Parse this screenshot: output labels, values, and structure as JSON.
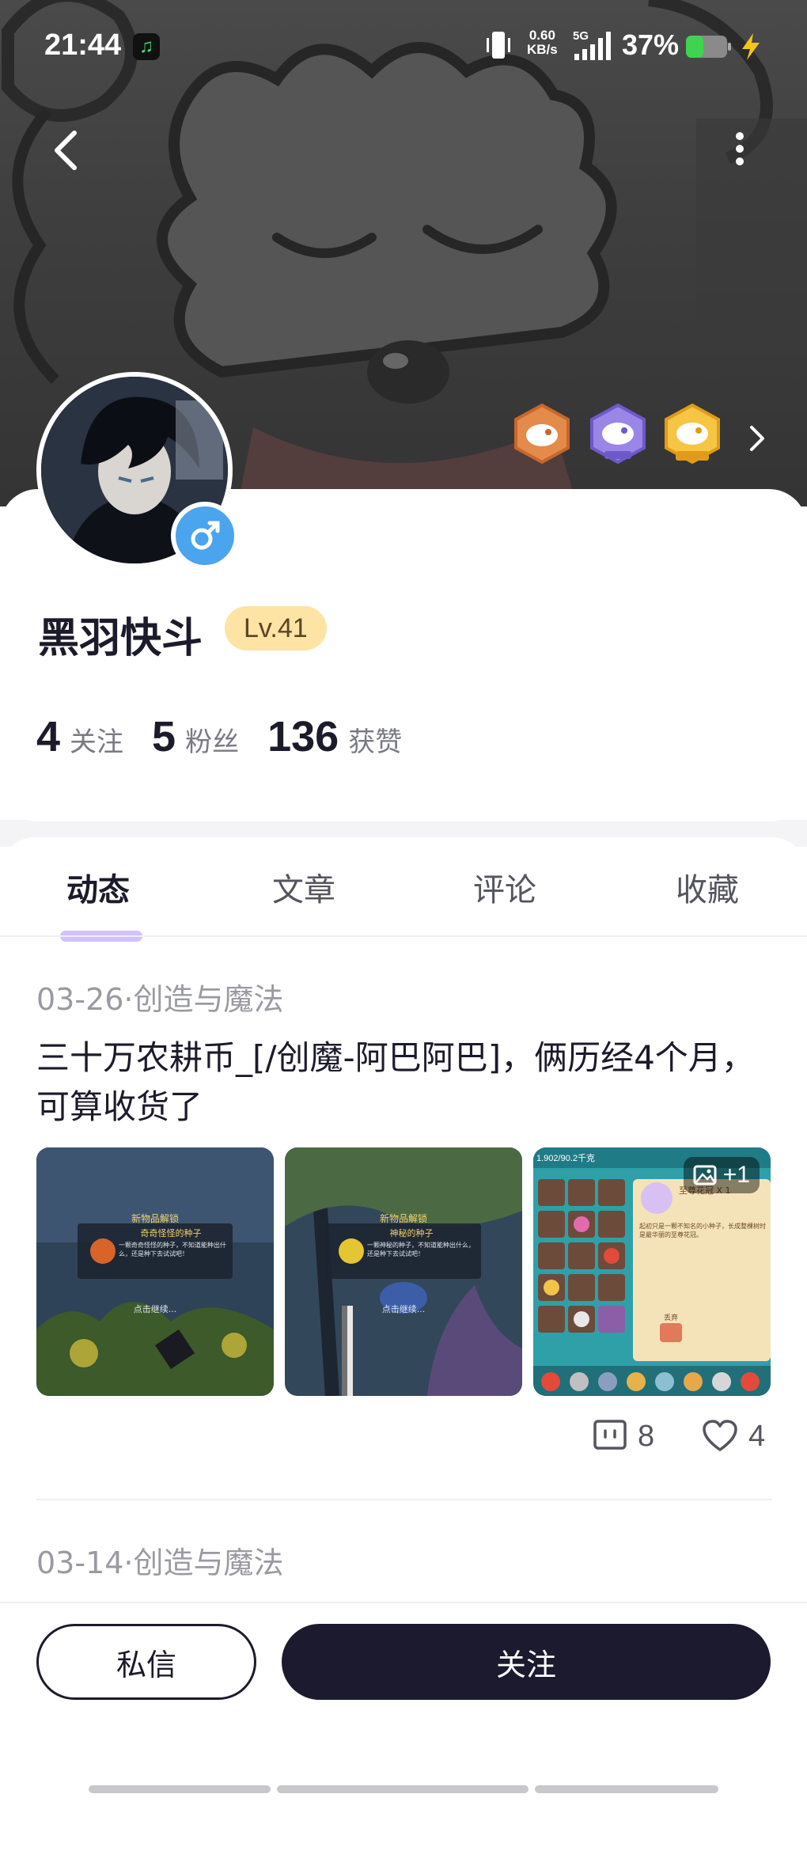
{
  "status_bar": {
    "time": "21:44",
    "net_speed_value": "0.60",
    "net_speed_unit": "KB/s",
    "network": "5G",
    "battery": "37%"
  },
  "profile": {
    "username": "黑羽快斗",
    "level": "Lv.41",
    "stats": [
      {
        "count": "4",
        "label": "关注"
      },
      {
        "count": "5",
        "label": "粉丝"
      },
      {
        "count": "136",
        "label": "获赞"
      }
    ]
  },
  "tabs": [
    "动态",
    "文章",
    "评论",
    "收藏"
  ],
  "posts": [
    {
      "date": "03-26",
      "category": "创造与魔法",
      "title": "三十万农耕币_[/创魔-阿巴阿巴]，俩历经4个月，可算收货了",
      "images": [
        {
          "banner": "新物品解锁",
          "item": "奇奇怪怪的种子",
          "desc": "一颗奇奇怪怪的种子，不知道能种出什么，还是种下去试试吧！",
          "hint": "点击继续..."
        },
        {
          "banner": "新物品解锁",
          "item": "神秘的种子",
          "desc": "一颗神秘的种子，不知道能种出什么，还是种下去试试吧！",
          "hint": "点击继续..."
        },
        {
          "weight": "1.902/90.2千克",
          "item": "至尊花冠 X 1",
          "desc": "起初只是一颗不知名的小种子，长成整棵树时是最华丽的至尊花冠。",
          "button": "丢弃"
        }
      ],
      "more_images": "+1",
      "comments": "8",
      "likes": "4"
    },
    {
      "date": "03-14",
      "category": "创造与魔法"
    }
  ],
  "actions": {
    "message": "私信",
    "follow": "关注"
  },
  "colors": {
    "accent_dark": "#1b1a2e",
    "level_badge": "#fde3a4",
    "tab_underline": "#c9b6ff",
    "gender_male": "#4aa4ee"
  }
}
